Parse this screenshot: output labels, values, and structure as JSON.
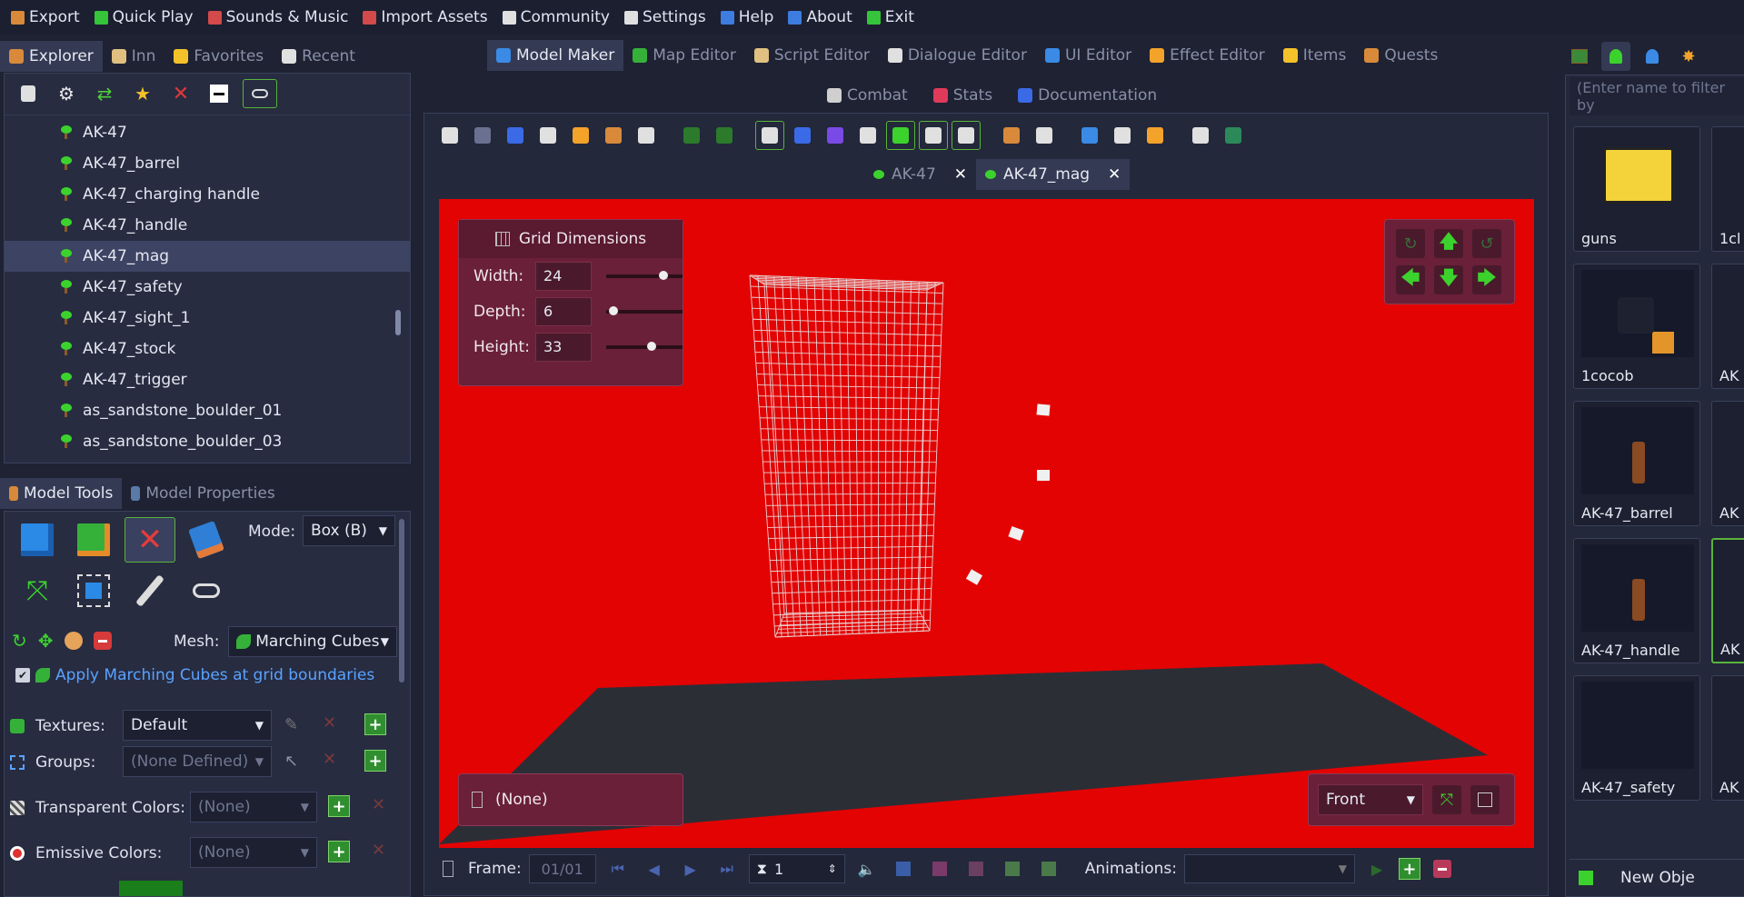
{
  "menu": [
    {
      "label": "Export",
      "icon": "export-icon",
      "color": "#d88a3a"
    },
    {
      "label": "Quick Play",
      "icon": "play-icon",
      "color": "#35c43a"
    },
    {
      "label": "Sounds & Music",
      "icon": "speaker-icon",
      "color": "#d24a4a"
    },
    {
      "label": "Import Assets",
      "icon": "import-icon",
      "color": "#d24a4a"
    },
    {
      "label": "Community",
      "icon": "steam-icon",
      "color": "#e0e0e0"
    },
    {
      "label": "Settings",
      "icon": "gear-icon",
      "color": "#e0e0e0"
    },
    {
      "label": "Help",
      "icon": "help-icon",
      "color": "#3d7de0"
    },
    {
      "label": "About",
      "icon": "info-icon",
      "color": "#3d7de0"
    },
    {
      "label": "Exit",
      "icon": "exit-icon",
      "color": "#35c43a"
    }
  ],
  "explorer": {
    "tabs": [
      {
        "label": "Explorer",
        "icon": "explorer-icon",
        "active": true
      },
      {
        "label": "Inn",
        "icon": "inn-icon",
        "active": false
      },
      {
        "label": "Favorites",
        "icon": "star-icon",
        "active": false
      },
      {
        "label": "Recent",
        "icon": "hourglass-icon",
        "active": false
      }
    ],
    "items": [
      "AK-47",
      "AK-47_barrel",
      "AK-47_charging handle",
      "AK-47_handle",
      "AK-47_mag",
      "AK-47_safety",
      "AK-47_sight_1",
      "AK-47_stock",
      "AK-47_trigger",
      "as_sandstone_boulder_01",
      "as_sandstone_boulder_03"
    ],
    "selected": "AK-47_mag"
  },
  "model_tools": {
    "tabs": [
      {
        "label": "Model Tools",
        "active": true
      },
      {
        "label": "Model Properties",
        "active": false
      }
    ],
    "mode_label": "Mode:",
    "mode_value": "Box (B)",
    "mesh_label": "Mesh:",
    "mesh_value": "Marching Cubes",
    "apply_mc_label": "Apply Marching Cubes at grid boundaries",
    "textures_label": "Textures:",
    "textures_value": "Default",
    "groups_label": "Groups:",
    "groups_value": "(None Defined)",
    "transparent_label": "Transparent Colors:",
    "transparent_value": "(None)",
    "emissive_label": "Emissive Colors:",
    "emissive_value": "(None)"
  },
  "editor_tabs": [
    {
      "label": "Model Maker",
      "active": true
    },
    {
      "label": "Map Editor",
      "active": false
    },
    {
      "label": "Script Editor",
      "active": false
    },
    {
      "label": "Dialogue Editor",
      "active": false
    },
    {
      "label": "UI Editor",
      "active": false
    },
    {
      "label": "Effect Editor",
      "active": false
    },
    {
      "label": "Items",
      "active": false
    },
    {
      "label": "Quests",
      "active": false
    }
  ],
  "editor_tabs2": [
    {
      "label": "Combat"
    },
    {
      "label": "Stats"
    },
    {
      "label": "Documentation"
    }
  ],
  "doc_tabs": [
    {
      "label": "AK-47",
      "active": false
    },
    {
      "label": "AK-47_mag",
      "active": true
    }
  ],
  "grid_dimensions": {
    "title": "Grid Dimensions",
    "width_label": "Width:",
    "width": "24",
    "width_frac": 0.75,
    "depth_label": "Depth:",
    "depth": "6",
    "depth_frac": 0.1,
    "height_label": "Height:",
    "height": "33",
    "height_frac": 0.6
  },
  "viewport": {
    "bg_color": "#ff0000",
    "group_value": "(None)",
    "view_value": "Front"
  },
  "timeline": {
    "frame_label": "Frame:",
    "frame_value": "01/01",
    "speed_value": "1",
    "animations_label": "Animations:"
  },
  "right": {
    "filter_placeholder": "(Enter name to filter by",
    "thumbs": [
      {
        "label": "guns"
      },
      {
        "label": "1cocob"
      },
      {
        "label": "AK-47_barrel"
      },
      {
        "label": "AK-47_handle"
      },
      {
        "label": "AK-47_safety"
      }
    ],
    "thumbs_col2": [
      "1cl",
      "AK",
      "AK",
      "AK",
      "AK"
    ],
    "new_object_label": "New Obje"
  }
}
